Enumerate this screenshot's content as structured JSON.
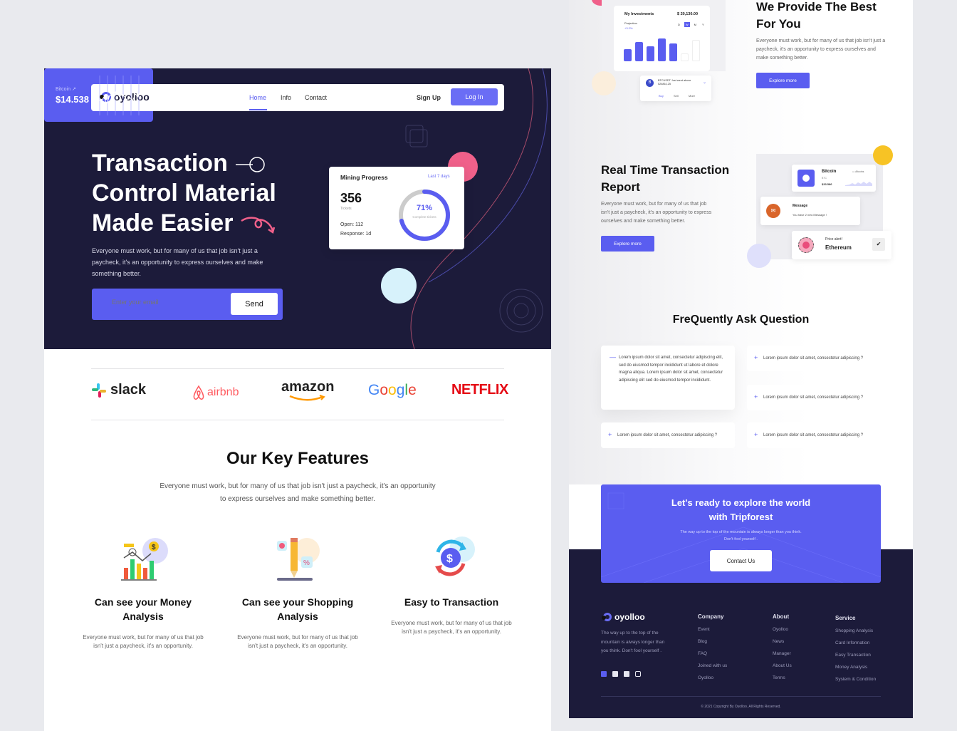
{
  "nav": {
    "brand": "oyolloo",
    "links": [
      "Home",
      "Info",
      "Contact"
    ],
    "active": "Home",
    "signup": "Sign Up",
    "login": "Log In"
  },
  "hero": {
    "title_lines": [
      "Transaction",
      "Control Material",
      "Made Easier"
    ],
    "description": "Everyone must work, but for many of us that job isn't just a paycheck, it's an opportunity to express ourselves and make something better.",
    "email_placeholder": "Enter your email",
    "send_label": "Send"
  },
  "mining_card": {
    "title": "Mining Progress",
    "period": "Last 7 days",
    "tickets_value": "356",
    "tickets_label": "Tickets",
    "open": "Open: 112",
    "response": "Response: 1d",
    "progress_label": "71%",
    "progress_value": 0.71,
    "progress_sub": "Complete tickets"
  },
  "bitcoin_card": {
    "label": "Bitcoin ↗",
    "value": "$14.538"
  },
  "brands": [
    "slack",
    "airbnb",
    "amazon",
    "Google",
    "NETFLIX"
  ],
  "features": {
    "title": "Our Key Features",
    "description": "Everyone must work, but for many of us that job isn't just a paycheck, it's an opportunity to express ourselves and make something better.",
    "items": [
      {
        "icon": "chart-icon",
        "title": "Can see your Money Analysis",
        "desc": "Everyone must work, but for many of us that job isn't just a paycheck, it's an opportunity."
      },
      {
        "icon": "pencil-icon",
        "title": "Can see your Shopping Analysis",
        "desc": "Everyone must work, but for many of us that job isn't just a paycheck, it's an opportunity."
      },
      {
        "icon": "exchange-dollar-icon",
        "title": "Easy to Transaction",
        "desc": "Everyone must work, but for many of us that job isn't just a paycheck, it's an opportunity."
      }
    ]
  },
  "investments": {
    "title": "My Investments",
    "amount": "$ 20,130.00",
    "projection_label": "Projection",
    "projection_value": "+3.2%",
    "periods": [
      "D",
      "W",
      "M",
      "Y"
    ],
    "active_period": "W",
    "bars": [
      0.45,
      0.7,
      0.55,
      0.85,
      0.65,
      0.3,
      0.8
    ],
    "notification": "BTCUSDT Just went above 52486,125",
    "actions": [
      "Buy",
      "Sell",
      "More"
    ]
  },
  "provide": {
    "title": "We Provide The Best For You",
    "description": "Everyone must work, but for many of us that job isn't just a paycheck, it's an opportunity to express ourselves and make something better.",
    "button": "Explore more"
  },
  "realtime": {
    "title": "Real Time Transaction Report",
    "description": "Everyone must work, but for many of us that job isn't just a paycheck, it's an opportunity to express ourselves and make something better.",
    "button": "Explore more",
    "bitcoin": {
      "name": "Bitcoin",
      "ticker": "BTC",
      "value": "$33.586",
      "tag": "Altcoins"
    },
    "message": {
      "title": "Message",
      "text": "You have 2 new Message !"
    },
    "alert": {
      "title": "Price alert!",
      "coin": "Ethereum"
    }
  },
  "faq": {
    "title": "FreQuently Ask Question",
    "open_item": "Lorem ipsum dolor sit amet, consectetur adipiscing elit, sed do eiusmod tempor incididunt ut labore et dolore magna aliqua. Lorem ipsum dolor sit amet, consectetur adipiscing elit sed do eiusmod tempor incididunt.",
    "items": [
      "Lorem ipsum dolor sit amet, consectetur adipiscing ?",
      "Lorem ipsum dolor sit amet, consectetur adipiscing ?",
      "Lorem ipsum dolor sit amet, consectetur adipiscing ?",
      "Lorem ipsum dolor sit amet, consectetur adipiscing ?"
    ]
  },
  "cta": {
    "title": "Let's ready to explore the world with Tripforest",
    "description": "The way up to the top of the mountain is always longer than you think. Don't fool yourself .",
    "button": "Contact Us"
  },
  "footer": {
    "brand": "oyolloo",
    "tagline": "The way up to the top of the mountain is always longer than you think. Don't fool yourself .",
    "social": [
      "facebook-icon",
      "twitter-icon",
      "linkedin-icon",
      "instagram-icon"
    ],
    "columns": [
      {
        "title": "Company",
        "items": [
          "Event",
          "Blog",
          "FAQ",
          "Joined with us",
          "Oyolloo"
        ]
      },
      {
        "title": "About",
        "items": [
          "Oyolloo",
          "News",
          "Manager",
          "About Us",
          "Terms"
        ]
      },
      {
        "title": "Service",
        "items": [
          "Shopping Analysis",
          "Card Information",
          "Easy Transaction",
          "Money Analysis",
          "System & Condition"
        ]
      }
    ],
    "copyright": "© 2021 Copyright By Oyolloo. All Rights Reserved."
  }
}
